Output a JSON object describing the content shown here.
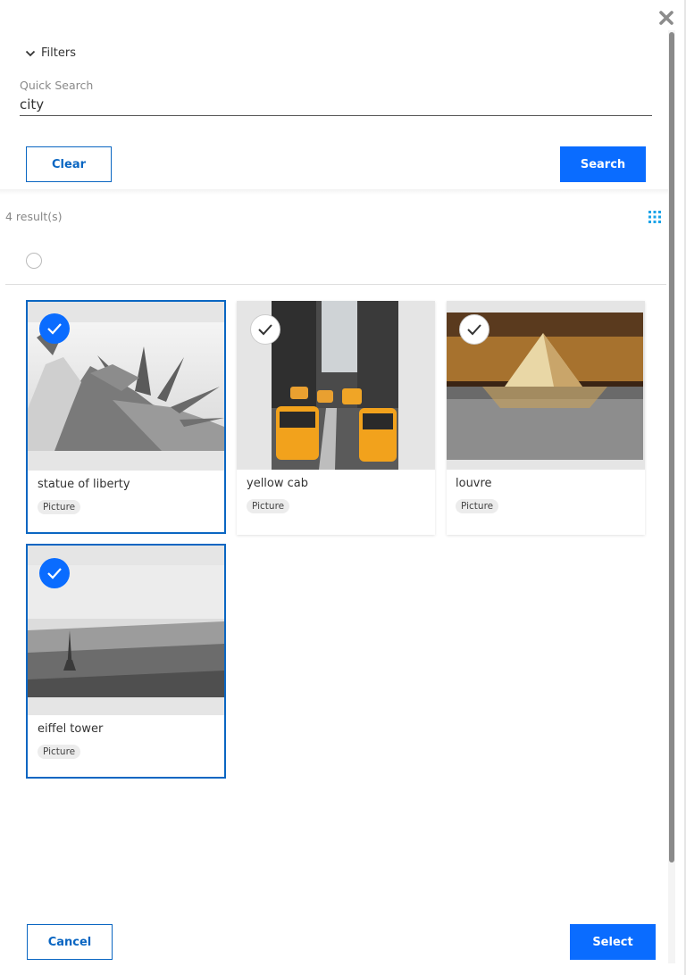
{
  "filters": {
    "toggle_label": "Filters",
    "quick_search_label": "Quick Search",
    "quick_search_value": "city",
    "clear_label": "Clear",
    "search_label": "Search"
  },
  "results": {
    "count_text": "4 result(s)",
    "view_icon": "grid-icon",
    "items": [
      {
        "title": "statue of liberty",
        "type": "Picture",
        "selected": true
      },
      {
        "title": "yellow cab",
        "type": "Picture",
        "selected": false
      },
      {
        "title": "louvre",
        "type": "Picture",
        "selected": false
      },
      {
        "title": "eiffel tower",
        "type": "Picture",
        "selected": true
      }
    ]
  },
  "footer": {
    "cancel_label": "Cancel",
    "select_label": "Select"
  },
  "colors": {
    "accent": "#0a6cff",
    "selected_border": "#0a66c2"
  }
}
